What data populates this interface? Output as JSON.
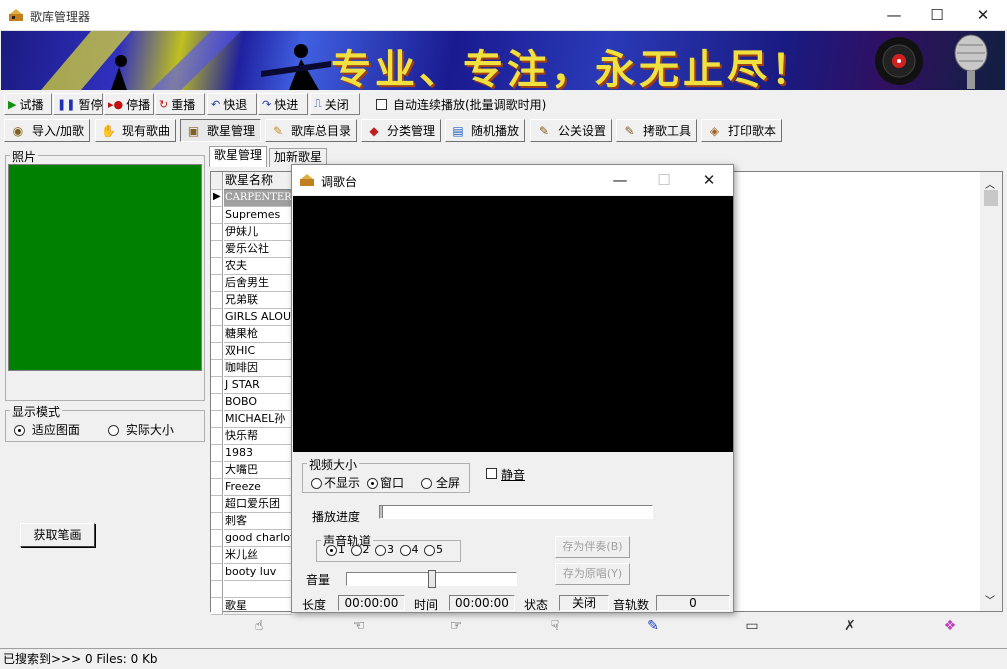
{
  "window": {
    "title": "歌库管理器",
    "minimize": "—",
    "maximize": "☐",
    "close": "✕"
  },
  "banner": {
    "slogan": "专业、专注，永无止尽！"
  },
  "playback_toolbar": {
    "play": "试播",
    "pause": "暂停",
    "stop": "停播",
    "replay": "重播",
    "rewind": "快退",
    "forward": "快进",
    "close": "关闭",
    "auto_play_label": "自动连续播放(批量调歌时用)"
  },
  "main_toolbar": {
    "import": "导入/加歌",
    "existing_songs": "现有歌曲",
    "singer_mgmt": "歌星管理",
    "catalog": "歌库总目录",
    "category_mgmt": "分类管理",
    "random_play": "随机播放",
    "public_settings": "公关设置",
    "copy_tool": "拷歌工具",
    "print_songbook": "打印歌本"
  },
  "left_panel": {
    "photo_label": "照片",
    "display_mode_label": "显示模式",
    "fit_label": "适应图面",
    "actual_label": "实际大小",
    "get_strokes_button": "获取笔画"
  },
  "tabs": {
    "singer_mgmt": "歌星管理",
    "add_singer": "加新歌星"
  },
  "grid": {
    "header": "歌星名称",
    "rows": [
      "CARPENTERS",
      "Supremes",
      "伊妹儿",
      "爱乐公社",
      "农夫",
      "后舍男生",
      "兄弟联",
      "GIRLS ALOUD",
      "糖果枪",
      "双HIC",
      "咖啡因",
      "J STAR",
      "BOBO",
      "MICHAEL孙",
      "快乐帮",
      "1983",
      "大嘴巴",
      "Freeze",
      "超口爱乐团",
      "刺客",
      "good charlotte",
      "米儿丝",
      "booty luv",
      "",
      "歌星"
    ]
  },
  "status_bar": {
    "text": "已搜索到>>> 0 Files: 0 Kb"
  },
  "dialog": {
    "title": "调歌台",
    "video_size_label": "视频大小",
    "no_display": "不显示",
    "window": "窗口",
    "fullscreen": "全屏",
    "mute": "静音",
    "progress_label": "播放进度",
    "audio_track_label": "声音轨道",
    "tracks": [
      "1",
      "2",
      "3",
      "4",
      "5"
    ],
    "save_accompaniment": "存为伴奏(B)",
    "save_original": "存为原唱(Y)",
    "volume_label": "音量",
    "volume_level": 0.5,
    "length_label": "长度",
    "length_value": "00:00:00",
    "time_label": "时间",
    "time_value": "00:00:00",
    "state_label": "状态",
    "state_value": "关闭",
    "track_count_label": "音轨数",
    "track_count_value": "0"
  }
}
